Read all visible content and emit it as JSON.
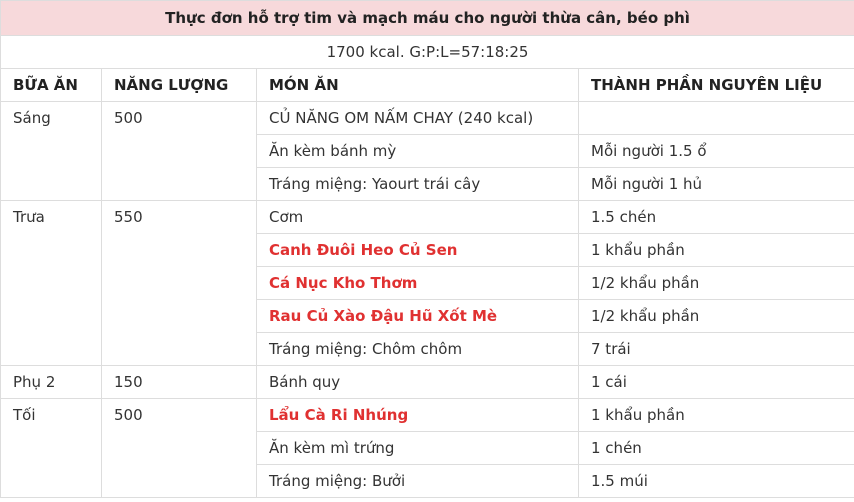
{
  "title": "Thực đơn hỗ trợ tim và mạch máu cho người thừa cân, béo phì",
  "subtitle": "1700 kcal. G:P:L=57:18:25",
  "headers": {
    "meal": "BỮA ĂN",
    "energy": "NĂNG LƯỢNG",
    "dish": "MÓN ĂN",
    "ingredients": "THÀNH PHẦN NGUYÊN LIỆU"
  },
  "colors": {
    "title_bg": "#f7d9db",
    "link_red": "#e03131",
    "border": "#dddddd"
  },
  "meals": [
    {
      "name": "Sáng",
      "energy": "500",
      "items": [
        {
          "dish": "CỦ NĂNG OM NẤM CHAY (240 kcal)",
          "amount": "",
          "link": false
        },
        {
          "dish": "Ăn kèm bánh mỳ",
          "amount": "Mỗi người 1.5 ổ",
          "link": false
        },
        {
          "dish": "Tráng miệng: Yaourt trái cây",
          "amount": "Mỗi người 1 hủ",
          "link": false
        }
      ]
    },
    {
      "name": "Trưa",
      "energy": "550",
      "items": [
        {
          "dish": "Cơm",
          "amount": "1.5 chén",
          "link": false
        },
        {
          "dish": "Canh Đuôi Heo Củ Sen",
          "amount": "1 khẩu phần",
          "link": true
        },
        {
          "dish": "Cá Nục Kho Thơm",
          "amount": "1/2 khẩu phần",
          "link": true
        },
        {
          "dish": "Rau Củ Xào Đậu Hũ Xốt Mè",
          "amount": "1/2 khẩu phần",
          "link": true
        },
        {
          "dish": "Tráng miệng: Chôm chôm",
          "amount": "7 trái",
          "link": false
        }
      ]
    },
    {
      "name": "Phụ 2",
      "energy": "150",
      "items": [
        {
          "dish": "Bánh quy",
          "amount": "1 cái",
          "link": false
        }
      ]
    },
    {
      "name": "Tối",
      "energy": "500",
      "items": [
        {
          "dish": "Lẩu Cà Ri Nhúng",
          "amount": "1 khẩu phần",
          "link": true
        },
        {
          "dish": "Ăn kèm mì trứng",
          "amount": "1 chén",
          "link": false
        },
        {
          "dish": "Tráng miệng: Bưởi",
          "amount": "1.5 múi",
          "link": false
        }
      ]
    }
  ]
}
